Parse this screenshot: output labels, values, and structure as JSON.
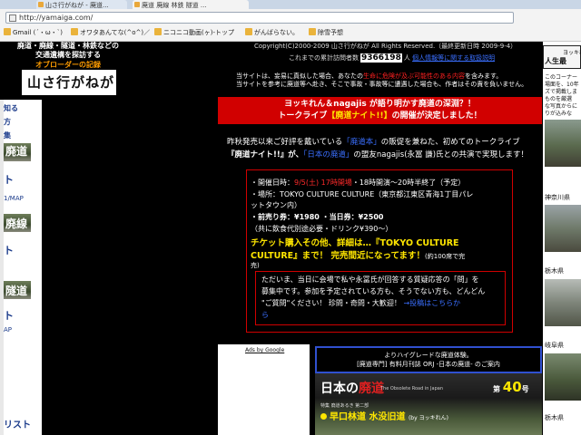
{
  "browser": {
    "tabs": [
      {
        "label": "山さ行がねが - 廃道...",
        "active": false
      },
      {
        "label": "廃道 廃線 林鉄 隧道 ...",
        "active": true
      }
    ],
    "url": "http://yamaiga.com/",
    "bookmarks": [
      "Gmail (´・ω・`)",
      "オワタあんてな(^o^)／",
      "ニコニコ動画(ヶ)-トップ",
      "がんばらない。",
      "除雪予想"
    ]
  },
  "site_header": {
    "tagline_line1": "廃道・廃線・隧道・林鉄などの",
    "tagline_line2": "交通遺構を探訪する",
    "tagline_line3": "オブローダーの記録",
    "logo_text": "山さ行がねが"
  },
  "left_nav": [
    "知る",
    "方",
    "集",
    "廃道",
    "ト",
    "1/MAP",
    "廃線",
    "ト",
    "隧道",
    "ト",
    "AP",
    "リスト"
  ],
  "notices": {
    "copyright": "Copyright(C)2000-2009 山さ行がねが All Rights Reserved.（最終更新日時 2009-9-4）",
    "counter_prefix": "これまでの累計訪問者数",
    "counter_value": "9366198",
    "counter_suffix": "人",
    "counter_link": "個人情報等に関する取扱説明",
    "warning1_a": "当サイトは、妄易に真似した場合、あなたの",
    "warning1_red": "生命に危険が及ぶ可能性のある内容",
    "warning1_b": "を含みます。",
    "warning2": "当サイトを参考に廃道等へ赴き、そこで事故・事故等に遭遇した場合も、作者はその責を負いません。"
  },
  "banner": {
    "line1": "ヨッキれん＆nagajis が語り明かす廃道の深淵？！",
    "line2_prefix": "トークライブ",
    "line2_highlight": "【廃道ナイト!!】",
    "line2_suffix": "の開催が決定しました！"
  },
  "intro": {
    "a": "昨秋発売以来ご好評を戴いている",
    "b": "「廃道本」",
    "c": "の販促を兼ねた、初めてのトークライブ",
    "d": "『廃道ナイト!!』が、",
    "e": "「日本の廃道」",
    "f": "の盟友nagajis(永冨 謙)氏との共演で実現します！"
  },
  "event": {
    "date_label": "・開催日時：",
    "date_value": "9/5(土) 17時開場",
    "date_rest": "・18時開演〜20時半終了（予定）",
    "place": "・場所：TOKYO CULTURE CULTURE（東京都江東区青海1丁目パレ",
    "place2": "ットタウン内）",
    "ticket": "・前売り券：¥1980 ・当日券：¥2500",
    "ticket_note": "（共に飲食代別途必要・ドリンク¥390〜）",
    "cta1": "チケット購入その他、詳細は…『TOKYO CULTURE",
    "cta2": "CULTURE』まで！ 完売間近になってます！",
    "cta_note": "(約100席で完",
    "cta_note2": "売)",
    "inner_line1": "ただいま、当日に会場で私や永冨氏が回答する質疑応答の「問」を",
    "inner_line2": "募集中です。参加を予定されている方も、そうでない方も、どんどん",
    "inner_line3": "\"ご質問\"ください！ 珍問・奇問・大歓迎！",
    "inner_link": "→投稿はこちらか",
    "inner_link2": "ら"
  },
  "ads": {
    "label": "Ads by Google",
    "promo_line1": "よりハイグレードな廃道体験。",
    "promo_line2": "[廃道専門] 有料月刊誌 ORJ -日本の廃道- のご案内",
    "magazine_title_a": "日本の",
    "magazine_title_b": "廃道",
    "magazine_subtitle": "The Obsolete Road in Japan",
    "magazine_issue_prefix": "第",
    "magazine_issue_num": "40",
    "magazine_issue_suffix": "号",
    "magazine_special": "特集 廃道あるき 第二部",
    "magazine_feature": "早口林道 水没旧道",
    "magazine_feature_by": "(by ヨッキれん)"
  },
  "right_column": {
    "header": "ヨッキれ",
    "header2": "人生最",
    "desc1": "このコーナー",
    "desc2": "場面を、10年",
    "desc3": "ズで掲載しま",
    "desc4": "ものを厳選",
    "desc5": "な写真からに",
    "desc6": "りが込みな",
    "cap1": "神奈川県",
    "cap2": "栃木県",
    "cap3": "岐阜県",
    "cap4": "栃木県"
  }
}
